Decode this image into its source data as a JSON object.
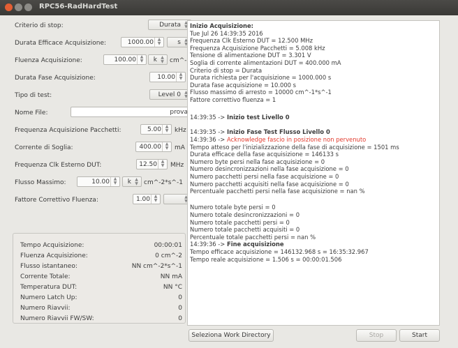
{
  "window": {
    "title": "RPC56-RadHardTest"
  },
  "form": {
    "criterio_stop": {
      "label": "Criterio di stop:",
      "value": "Durata"
    },
    "durata_efficace": {
      "label": "Durata Efficace Acquisizione:",
      "value": "1000.00",
      "unit": "s"
    },
    "fluenza": {
      "label": "Fluenza Acquisizione:",
      "value": "100.00",
      "prefix": "k",
      "unit": "cm^-2"
    },
    "durata_fase": {
      "label": "Durata Fase Acquisizione:",
      "value": "10.00",
      "unit": "s"
    },
    "tipo_test": {
      "label": "Tipo di test:",
      "value": "Level 0"
    },
    "nome_file": {
      "label": "Nome File:",
      "value": "prova"
    },
    "freq_pacchetti": {
      "label": "Frequenza Acquisizione Pacchetti:",
      "value": "5.00",
      "unit": "kHz"
    },
    "corrente_soglia": {
      "label": "Corrente di Soglia:",
      "value": "400.00",
      "unit": "mA"
    },
    "freq_clk": {
      "label": "Frequenza Clk Esterno DUT:",
      "value": "12.50",
      "unit": "MHz"
    },
    "flusso_massimo": {
      "label": "Flusso Massimo:",
      "value": "10.00",
      "prefix": "k",
      "unit": "cm^-2*s^-1"
    },
    "fattore_corr": {
      "label": "Fattore Correttivo Fluenza:",
      "value": "1.00",
      "unit": ""
    }
  },
  "stats": [
    {
      "label": "Tempo Acquisizione:",
      "value": "00:00:01"
    },
    {
      "label": "Fluenza Acquisizione:",
      "value": "0 cm^-2"
    },
    {
      "label": "Flusso istantaneo:",
      "value": "NN cm^-2*s^-1"
    },
    {
      "label": "Corrente Totale:",
      "value": "NN mA"
    },
    {
      "label": "Temperatura DUT:",
      "value": "NN °C"
    },
    {
      "label": "Numero Latch Up:",
      "value": "0"
    },
    {
      "label": "Numero Riavvii:",
      "value": "0"
    },
    {
      "label": "Numero Riavvii FW/SW:",
      "value": "0"
    }
  ],
  "log": [
    {
      "t": "Inizio Acquisizione:",
      "s": "b"
    },
    {
      "t": "Tue Jul 26 14:39:35 2016"
    },
    {
      "t": "Frequenza Clk Esterno DUT = 12.500 MHz"
    },
    {
      "t": "Frequenza Acquisizione Pacchetti = 5.008 kHz"
    },
    {
      "t": "Tensione di alimentazione DUT = 3.301 V"
    },
    {
      "t": "Soglia di corrente alimentazioni DUT = 400.000 mA"
    },
    {
      "t": "Criterio di stop = Durata"
    },
    {
      "t": "Durata richiesta per l'acquisizione = 1000.000 s"
    },
    {
      "t": "Durata fase acquisizione = 10.000 s"
    },
    {
      "t": "Flusso massimo di arresto = 10000 cm^-1*s^-1"
    },
    {
      "t": "Fattore correttivo fluenza = 1"
    },
    {
      "t": ""
    },
    {
      "p": "14:39:35 -> ",
      "t": "Inizio test Livello 0",
      "s": "b"
    },
    {
      "t": ""
    },
    {
      "p": "14:39:35 -> ",
      "t": "Inizio Fase Test Flusso Livello 0",
      "s": "b"
    },
    {
      "p": "14:39:36 -> ",
      "t": "Acknowledge fascio in posizione non pervenuto",
      "s": "red"
    },
    {
      "t": "Tempo atteso per l'inizializzazione della fase di acquisizione = 1501 ms"
    },
    {
      "t": "Durata efficace della fase acquisizione = 146133 s"
    },
    {
      "t": "Numero byte persi nella fase acquisizione = 0"
    },
    {
      "t": "Numero desincronizzazioni nella fase acquisizione = 0"
    },
    {
      "t": "Numero pacchetti persi nella fase acquisizione = 0"
    },
    {
      "t": "Numero pacchetti acquisiti nella fase acquisizione = 0"
    },
    {
      "t": "Percentuale pacchetti persi nella fase acquisizione = nan %"
    },
    {
      "t": ""
    },
    {
      "t": "Numero totale byte persi = 0"
    },
    {
      "t": "Numero totale desincronizzazioni = 0"
    },
    {
      "t": "Numero totale pacchetti persi = 0"
    },
    {
      "t": "Numero totale pacchetti acquisiti = 0"
    },
    {
      "t": "Percentuale totale pacchetti persi = nan %"
    },
    {
      "p": "14:39:36 -> ",
      "t": "Fine acquisizione",
      "s": "b"
    },
    {
      "t": "Tempo efficace acquisizione = 146132.968 s = 16:35:32.967"
    },
    {
      "t": "Tempo reale acquisizione = 1.506 s = 00:00:01.506"
    }
  ],
  "buttons": {
    "workdir": "Seleziona Work Directory",
    "stop": "Stop",
    "start": "Start"
  }
}
